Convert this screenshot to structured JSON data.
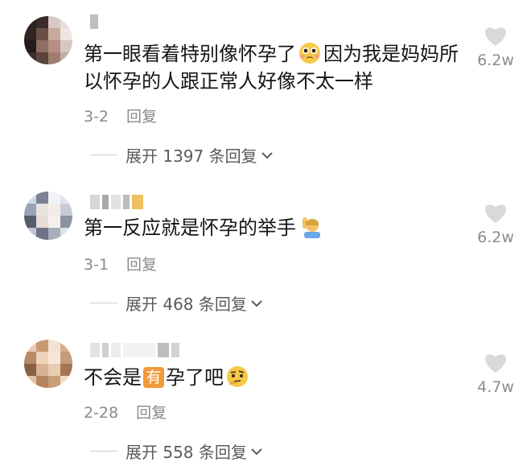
{
  "comments": [
    {
      "text_before": "第一眼看着特别像怀孕了",
      "text_after": "因为我是妈妈所以怀孕的人跟正常人好像不太一样",
      "emoji": "pleading-face",
      "date": "3-2",
      "reply_label": "回复",
      "likes": "6.2w",
      "expand_label": "展开 1397 条回复"
    },
    {
      "text_before": "第一反应就是怀孕的举手",
      "text_after": "",
      "emoji": "person-raising-hand",
      "date": "3-1",
      "reply_label": "回复",
      "likes": "6.2w",
      "expand_label": "展开 468 条回复"
    },
    {
      "text_before": "不会是",
      "highlight": "有",
      "text_after": "孕了吧",
      "emoji": "thinking-face",
      "date": "2-28",
      "reply_label": "回复",
      "likes": "4.7w",
      "expand_label": "展开 558 条回复"
    }
  ],
  "colors": {
    "text": "#151515",
    "meta": "#8a8a8a",
    "heart": "#d9d9d9",
    "badge": "#f29a3a"
  }
}
